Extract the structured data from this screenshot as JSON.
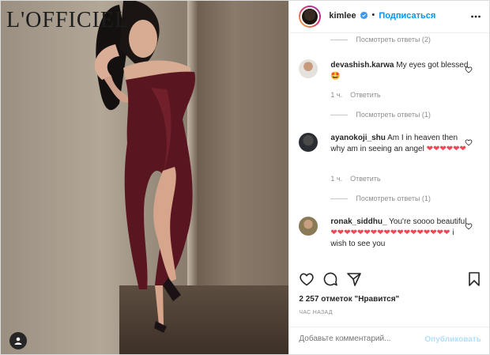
{
  "photo": {
    "brand": "L'OFFICIEL",
    "tag_icon": "user-tag-icon"
  },
  "header": {
    "username": "kimlee",
    "dot": "•",
    "follow_label": "Подписаться",
    "verified_icon": "verified-badge-icon",
    "more_icon": "more-horizontal-icon"
  },
  "comments": {
    "top_view_replies": "Посмотреть ответы (2)",
    "items": [
      {
        "user": "devashish.karwa",
        "text": "My eyes got blessed 🤩",
        "time": "1 ч.",
        "reply_label": "Ответить",
        "view_replies": "Посмотреть ответы (1)"
      },
      {
        "user": "ayanokoji_shu",
        "text": "Am I in heaven then why am in seeing an angel ❤❤❤❤❤❤",
        "time": "1 ч.",
        "reply_label": "Ответить",
        "view_replies": "Посмотреть ответы (1)"
      },
      {
        "user": "ronak_siddhu_",
        "text": "You're soooo beautiful ❤❤❤❤❤❤❤❤❤❤❤❤❤❤❤❤❤❤ i wish to see you",
        "time": "",
        "reply_label": "",
        "view_replies": ""
      }
    ]
  },
  "actions": {
    "like_icon": "heart-icon",
    "comment_icon": "comment-icon",
    "share_icon": "share-icon",
    "save_icon": "bookmark-icon"
  },
  "likes_text": "2 257 отметок \"Нравится\"",
  "time_text": "ЧАС НАЗАД",
  "add_comment": {
    "placeholder": "Добавьте комментарий...",
    "post_label": "Опубликовать"
  },
  "colors": {
    "accent": "#0095f6",
    "post_disabled": "#b2dffc",
    "muted": "#8e8e8e",
    "text": "#262626",
    "heart": "#ed4956"
  }
}
